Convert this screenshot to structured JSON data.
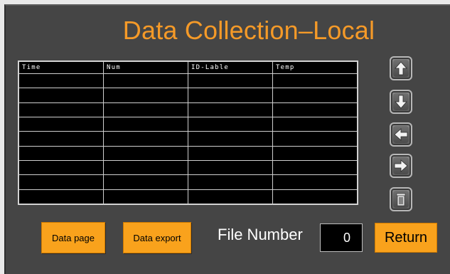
{
  "title": "Data Collection–Local",
  "table": {
    "columns": [
      "Time",
      "Num",
      "ID-Lable",
      "Temp"
    ],
    "rows": [
      [
        "",
        "",
        "",
        ""
      ],
      [
        "",
        "",
        "",
        ""
      ],
      [
        "",
        "",
        "",
        ""
      ],
      [
        "",
        "",
        "",
        ""
      ],
      [
        "",
        "",
        "",
        ""
      ],
      [
        "",
        "",
        "",
        ""
      ],
      [
        "",
        "",
        "",
        ""
      ],
      [
        "",
        "",
        "",
        ""
      ],
      [
        "",
        "",
        "",
        ""
      ]
    ]
  },
  "nav": {
    "icons": [
      "arrow-up-icon",
      "arrow-down-icon",
      "arrow-left-icon",
      "arrow-right-icon",
      "trash-icon"
    ]
  },
  "buttons": {
    "data_page": "Data page",
    "data_export": "Data export",
    "return": "Return"
  },
  "file_number": {
    "label": "File Number",
    "value": "0"
  },
  "colors": {
    "panel_bg": "#454545",
    "accent": "#f9a21c",
    "title": "#f59a28",
    "table_bg": "#000000"
  }
}
